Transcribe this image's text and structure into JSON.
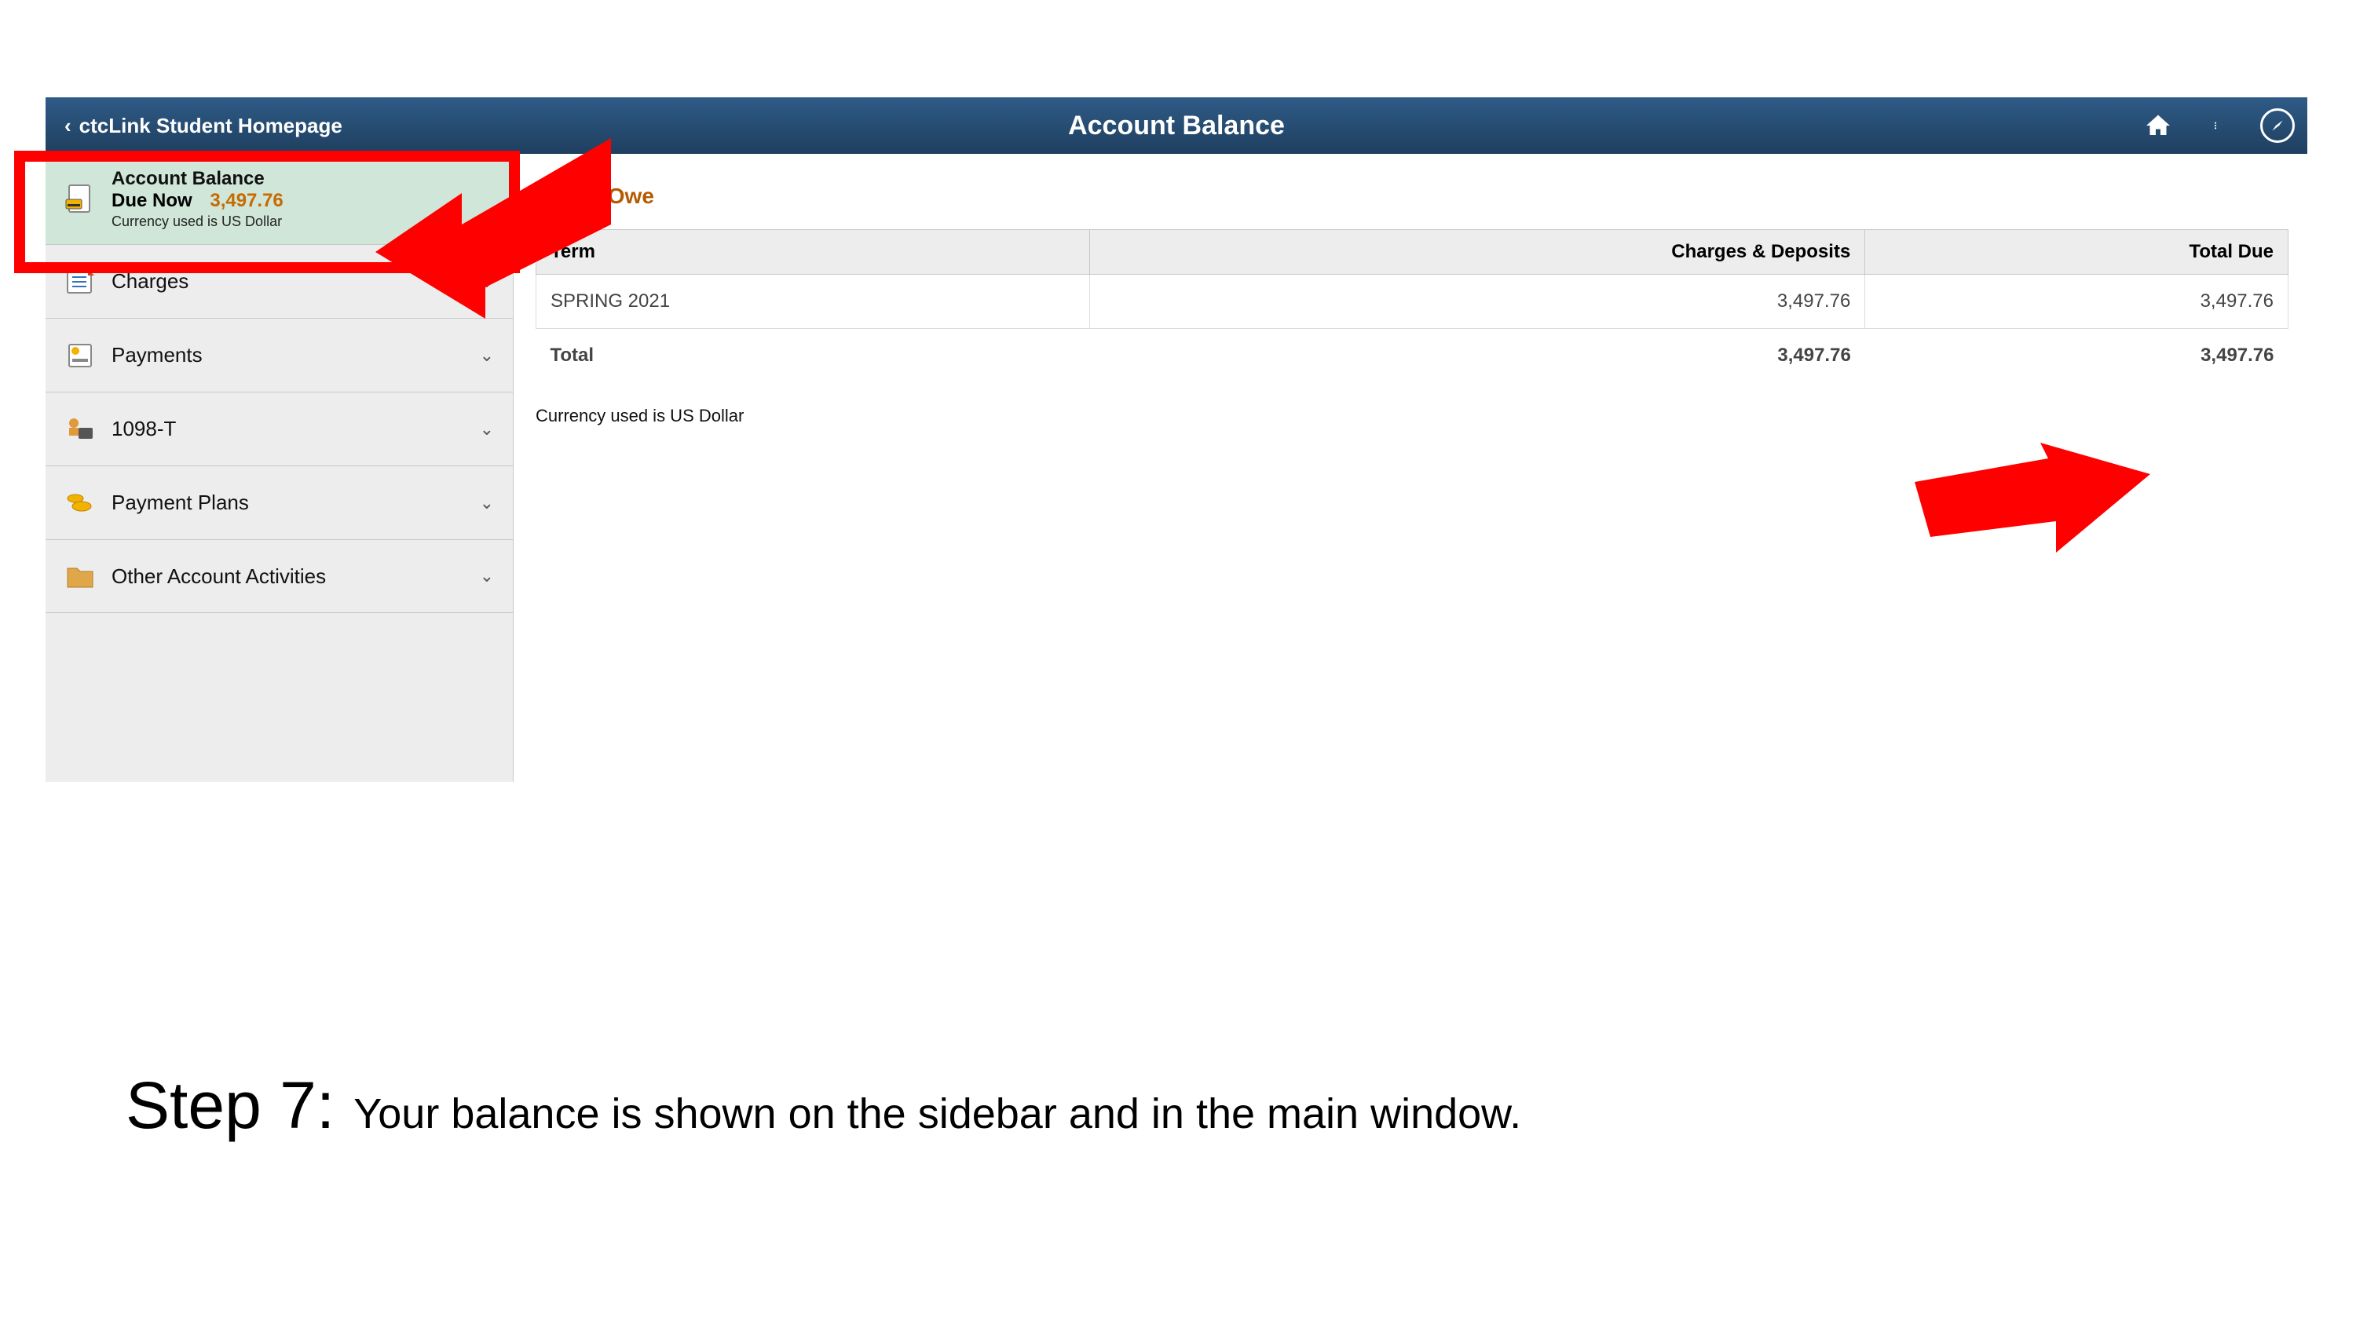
{
  "header": {
    "back_label": "ctcLink Student Homepage",
    "title": "Account Balance"
  },
  "sidebar": {
    "balance": {
      "title": "Account Balance",
      "due_label": "Due Now",
      "amount": "3,497.76",
      "currency_note": "Currency used is US Dollar"
    },
    "items": [
      {
        "label": "Charges"
      },
      {
        "label": "Payments"
      },
      {
        "label": "1098-T"
      },
      {
        "label": "Payment Plans"
      },
      {
        "label": "Other Account Activities"
      }
    ]
  },
  "main": {
    "section_title": "What I Owe",
    "columns": {
      "term": "Term",
      "charges": "Charges & Deposits",
      "total_due": "Total Due"
    },
    "rows": [
      {
        "term": "SPRING 2021",
        "charges": "3,497.76",
        "total_due": "3,497.76"
      }
    ],
    "totals": {
      "label": "Total",
      "charges": "3,497.76",
      "total_due": "3,497.76"
    },
    "currency_note": "Currency used is US Dollar"
  },
  "annotation": {
    "step_label": "Step 7:",
    "step_desc": "Your balance is shown on the sidebar and in the main window."
  }
}
